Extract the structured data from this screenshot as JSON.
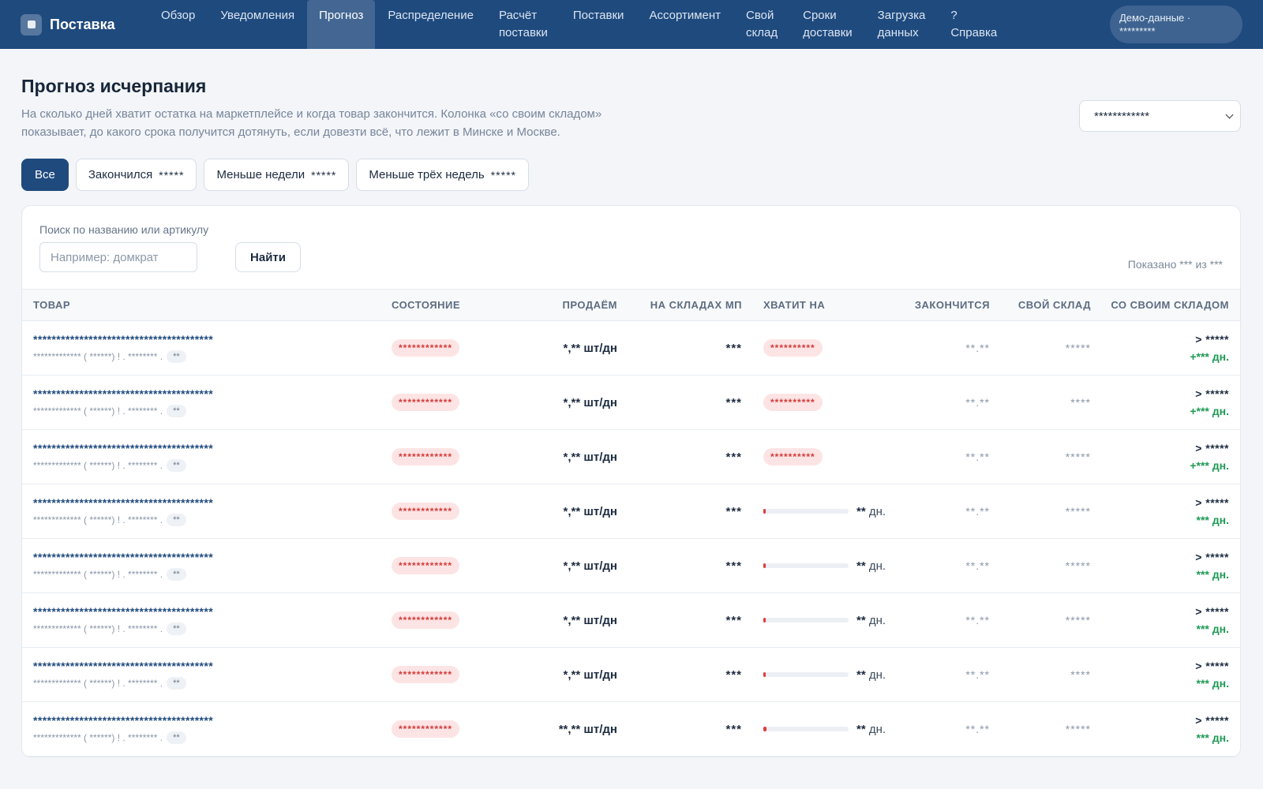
{
  "app": {
    "name": "Поставка",
    "nav": [
      {
        "label": "Обзор",
        "active": false
      },
      {
        "label": "Уведомления",
        "active": false
      },
      {
        "label": "Прогноз",
        "active": true
      },
      {
        "label": "Распределение",
        "active": false
      },
      {
        "label": "Расчёт\nпоставки",
        "active": false
      },
      {
        "label": "Поставки",
        "active": false
      },
      {
        "label": "Ассортимент",
        "active": false
      },
      {
        "label": "Свой\nсклад",
        "active": false
      },
      {
        "label": "Сроки\nдоставки",
        "active": false
      },
      {
        "label": "Загрузка\nданных",
        "active": false
      },
      {
        "label": "?\nСправка",
        "active": false
      }
    ],
    "demo_label": "Демо-данные ·\n*********"
  },
  "page": {
    "title": "Прогноз исчерпания",
    "description": "На сколько дней хватит остатка на маркетплейсе и когда товар закончится. Колонка «со своим складом» показывает, до какого срока получится дотянуть, если довезти всё, что лежит в Минске и Москве.",
    "select_value": "************"
  },
  "filters": [
    {
      "label": "Все",
      "count": "",
      "active": true
    },
    {
      "label": "Закончился",
      "count": "*****",
      "active": false
    },
    {
      "label": "Меньше недели",
      "count": "*****",
      "active": false
    },
    {
      "label": "Меньше трёх недель",
      "count": "*****",
      "active": false
    }
  ],
  "search": {
    "label": "Поиск по названию или артикулу",
    "placeholder": "Например: домкрат",
    "button": "Найти",
    "shown": "Показано *** из ***"
  },
  "table": {
    "columns": [
      "ТОВАР",
      "СОСТОЯНИЕ",
      "ПРОДАЁМ",
      "НА СКЛАДАХ МП",
      "ХВАТИТ НА",
      "ЗАКОНЧИТСЯ",
      "СВОЙ СКЛАД",
      "СО СВОИМ СКЛАДОМ"
    ],
    "rows": [
      {
        "name": "***************************************",
        "sub": "************* ( ******) ! . ******** .",
        "tag": "**",
        "state": "************",
        "sell": "*,** шт/дн",
        "stock": "***",
        "enough_badge": "**********",
        "enough_days": "",
        "enough_fraction": null,
        "ends": "**.**",
        "own": "*****",
        "with_top": "> *****",
        "with_bot": "+*** дн."
      },
      {
        "name": "***************************************",
        "sub": "************* ( ******) ! . ******** .",
        "tag": "**",
        "state": "************",
        "sell": "*,** шт/дн",
        "stock": "***",
        "enough_badge": "**********",
        "enough_days": "",
        "enough_fraction": null,
        "ends": "**.**",
        "own": "****",
        "with_top": "> *****",
        "with_bot": "+*** дн."
      },
      {
        "name": "***************************************",
        "sub": "************* ( ******) ! . ******** .",
        "tag": "**",
        "state": "************",
        "sell": "*,** шт/дн",
        "stock": "***",
        "enough_badge": "**********",
        "enough_days": "",
        "enough_fraction": null,
        "ends": "**.**",
        "own": "*****",
        "with_top": "> *****",
        "with_bot": "+*** дн."
      },
      {
        "name": "***************************************",
        "sub": "************* ( ******) ! . ******** .",
        "tag": "**",
        "state": "************",
        "sell": "*,** шт/дн",
        "stock": "***",
        "enough_badge": "",
        "enough_days": "**",
        "enough_unit": "дн.",
        "enough_fraction": 0.03,
        "ends": "**.**",
        "own": "*****",
        "with_top": "> *****",
        "with_bot": "*** дн."
      },
      {
        "name": "***************************************",
        "sub": "************* ( ******) ! . ******** .",
        "tag": "**",
        "state": "************",
        "sell": "*,** шт/дн",
        "stock": "***",
        "enough_badge": "",
        "enough_days": "**",
        "enough_unit": "дн.",
        "enough_fraction": 0.03,
        "ends": "**.**",
        "own": "*****",
        "with_top": "> *****",
        "with_bot": "*** дн."
      },
      {
        "name": "***************************************",
        "sub": "************* ( ******) ! . ******** .",
        "tag": "**",
        "state": "************",
        "sell": "*,** шт/дн",
        "stock": "***",
        "enough_badge": "",
        "enough_days": "**",
        "enough_unit": "дн.",
        "enough_fraction": 0.03,
        "ends": "**.**",
        "own": "*****",
        "with_top": "> *****",
        "with_bot": "*** дн."
      },
      {
        "name": "***************************************",
        "sub": "************* ( ******) ! . ******** .",
        "tag": "**",
        "state": "************",
        "sell": "*,** шт/дн",
        "stock": "***",
        "enough_badge": "",
        "enough_days": "**",
        "enough_unit": "дн.",
        "enough_fraction": 0.03,
        "ends": "**.**",
        "own": "****",
        "with_top": "> *****",
        "with_bot": "*** дн."
      },
      {
        "name": "***************************************",
        "sub": "************* ( ******) ! . ******** .",
        "tag": "**",
        "state": "************",
        "sell": "**,** шт/дн",
        "stock": "***",
        "enough_badge": "",
        "enough_days": "**",
        "enough_unit": "дн.",
        "enough_fraction": 0.04,
        "ends": "**.**",
        "own": "*****",
        "with_top": "> *****",
        "with_bot": "*** дн."
      }
    ]
  },
  "colors": {
    "topbar": "#1f4a7e",
    "accent": "#1f4a7e",
    "danger": "#d63a3a",
    "positive": "#1e9a55"
  }
}
